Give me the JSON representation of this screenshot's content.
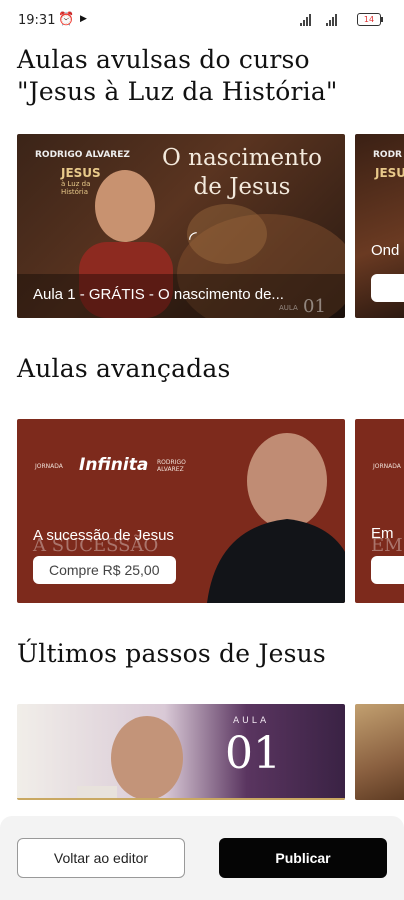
{
  "status_bar": {
    "time": "19:31",
    "battery": "14"
  },
  "sections": [
    {
      "title_line1": "Aulas avulsas do curso",
      "title_line2": "\"Jesus à Luz da História\"",
      "cards": [
        {
          "title": "Aula 1 - GRÁTIS - O nascimento de...",
          "overlay_author": "RODRIGO ALVAREZ",
          "overlay_series": "JESUS",
          "overlay_sub": "à Luz da História",
          "overlay_heading": "O nascimento de Jesus",
          "overlay_number": "01",
          "overlay_aula": "AULA"
        },
        {
          "title": "Ond",
          "overlay_author": "RODR",
          "overlay_series": "JESU"
        }
      ]
    },
    {
      "title": "Aulas avançadas",
      "cards": [
        {
          "title": "A sucessão de Jesus",
          "price_button": "Compre R$ 25,00",
          "overlay_jornada": "JORNADA",
          "overlay_brand": "Infinita",
          "overlay_author": "RODRIGO ALVAREZ",
          "overlay_bg_word": "A SUCESSÃO"
        },
        {
          "title": "Em",
          "overlay_bg_word": "EM",
          "overlay_jornada": "JORNADA"
        }
      ]
    },
    {
      "title": "Últimos passos de Jesus",
      "cards": [
        {
          "overlay_aula": "AULA",
          "overlay_number": "01"
        }
      ]
    }
  ],
  "footer": {
    "back_label": "Voltar ao editor",
    "publish_label": "Publicar"
  },
  "colors": {
    "accent": "#050505",
    "card_red": "#7d2a1c",
    "card_purple": "#4a2a52"
  }
}
